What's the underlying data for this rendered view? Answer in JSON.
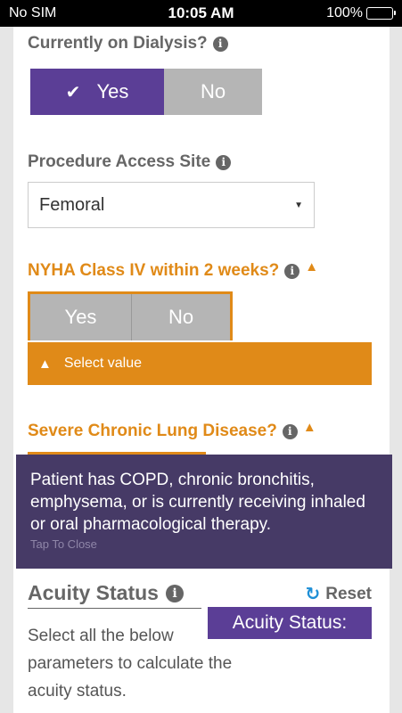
{
  "status_bar": {
    "carrier": "No SIM",
    "time": "10:05 AM",
    "battery": "100%",
    "battery_level": 1.0
  },
  "dialysis": {
    "label": "Currently on Dialysis?",
    "yes": "Yes",
    "no": "No",
    "selected": "yes"
  },
  "access_site": {
    "label": "Procedure Access Site",
    "value": "Femoral"
  },
  "nyha": {
    "label": "NYHA Class IV within 2 weeks?",
    "yes": "Yes",
    "no": "No",
    "error": "Select value"
  },
  "lung": {
    "label": "Severe Chronic Lung Disease?"
  },
  "tooltip": {
    "text": "Patient has COPD, chronic bronchitis, emphysema, or is currently receiving inhaled or oral pharmacological therapy.",
    "close": "Tap To Close"
  },
  "acuity": {
    "title": "Acuity Status",
    "reset": "Reset",
    "badge": "Acuity Status:",
    "instruction": "Select all the below parameters to calculate the acuity status."
  },
  "colors": {
    "purple": "#5b3e96",
    "orange": "#e08a18",
    "tooltip_bg": "#463a66",
    "reset_blue": "#1e8fd6"
  },
  "icons": {
    "info": "info-icon",
    "warning": "warning-icon",
    "check": "check-icon",
    "reset": "refresh-icon",
    "dropdown": "caret-down-icon"
  }
}
